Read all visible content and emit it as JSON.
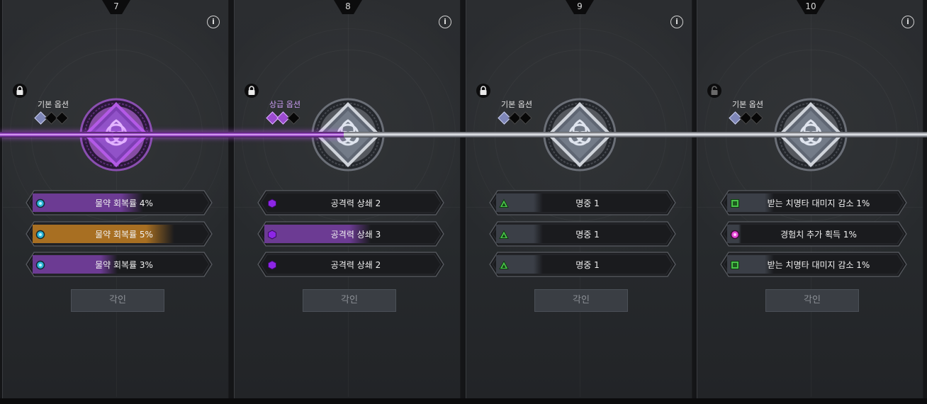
{
  "colors": {
    "fill_purple": "#6c3b93",
    "fill_gold": "#a86f22",
    "fill_gray": "#3b3f47",
    "cyan": "#2fb8d8",
    "violet": "#8d26e6",
    "green": "#49c24a",
    "magenta": "#e646d8"
  },
  "panels": [
    {
      "step": "7",
      "option_label": "기본 옵션",
      "label_style": "normal",
      "gems": [
        "blue",
        "off",
        "off"
      ],
      "node_style": "purple",
      "options": [
        {
          "text": "물약 회복률 4%",
          "icon": "cyan-circle-icon",
          "fill": "purple",
          "level": 0.78
        },
        {
          "text": "물약 회복률 5%",
          "icon": "cyan-circle-icon",
          "fill": "gold",
          "level": 1.0
        },
        {
          "text": "물약 회복률 3%",
          "icon": "cyan-circle-icon",
          "fill": "purple",
          "level": 0.6
        }
      ],
      "lock_state": "locked",
      "button": "각인"
    },
    {
      "step": "8",
      "option_label": "상급 옵션",
      "label_style": "upgrade",
      "gems": [
        "purple",
        "purple",
        "off"
      ],
      "node_style": "silver",
      "options": [
        {
          "text": "공격력 상쇄 2",
          "icon": "violet-hexagon-icon",
          "fill": "gray",
          "level": 0.0
        },
        {
          "text": "공격력 상쇄 3",
          "icon": "violet-hexagon-icon",
          "fill": "purple",
          "level": 0.75
        },
        {
          "text": "공격력 상쇄 2",
          "icon": "violet-hexagon-icon",
          "fill": "gray",
          "level": 0.0
        }
      ],
      "lock_state": "locked",
      "button": "각인"
    },
    {
      "step": "9",
      "option_label": "기본 옵션",
      "label_style": "normal",
      "gems": [
        "blue",
        "off",
        "off"
      ],
      "node_style": "silver",
      "options": [
        {
          "text": "명중 1",
          "icon": "green-triangle-icon",
          "fill": "gray",
          "level": 0.33
        },
        {
          "text": "명중 1",
          "icon": "green-triangle-icon",
          "fill": "gray",
          "level": 0.33
        },
        {
          "text": "명중 1",
          "icon": "green-triangle-icon",
          "fill": "gray",
          "level": 0.33
        }
      ],
      "lock_state": "locked",
      "button": "각인"
    },
    {
      "step": "10",
      "option_label": "기본 옵션",
      "label_style": "normal",
      "gems": [
        "blue",
        "off",
        "off"
      ],
      "node_style": "silver",
      "options": [
        {
          "text": "받는 치명타 대미지 감소 1%",
          "icon": "green-square-icon",
          "fill": "gray",
          "level": 0.33
        },
        {
          "text": "경험치 추가 획득 1%",
          "icon": "magenta-circle-icon",
          "fill": "gray",
          "level": 0.1
        },
        {
          "text": "받는 치명타 대미지 감소 1%",
          "icon": "green-square-icon",
          "fill": "gray",
          "level": 0.33
        }
      ],
      "lock_state": "unlocked",
      "button": "각인"
    }
  ]
}
